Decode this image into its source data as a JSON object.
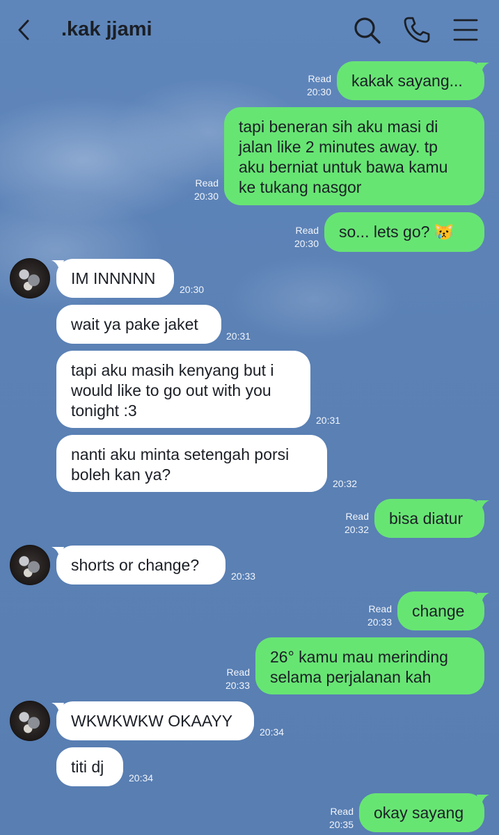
{
  "header": {
    "title": ".kak jjami",
    "back_icon": "chevron-left-icon",
    "search_icon": "search-icon",
    "call_icon": "phone-icon",
    "menu_icon": "hamburger-menu-icon"
  },
  "messages": [
    {
      "from": "me",
      "text": "kakak sayang...",
      "read": "Read",
      "time": "20:30"
    },
    {
      "from": "me",
      "text": "tapi beneran sih aku masi di\njalan like 2 minutes away. tp\naku berniat untuk bawa kamu\nke tukang nasgor",
      "read": "Read",
      "time": "20:30"
    },
    {
      "from": "me",
      "text": "so... lets go? 😿",
      "read": "Read",
      "time": "20:30"
    },
    {
      "from": "them",
      "text": "IM INNNNN",
      "time": "20:30"
    },
    {
      "from": "them",
      "text": "wait ya pake jaket",
      "time": "20:31"
    },
    {
      "from": "them",
      "text": "tapi aku masih kenyang but i\nwould like to go out with you\ntonight :3",
      "time": "20:31"
    },
    {
      "from": "them",
      "text": "nanti aku minta setengah porsi\nboleh kan ya?",
      "time": "20:32"
    },
    {
      "from": "me",
      "text": "bisa diatur",
      "read": "Read",
      "time": "20:32"
    },
    {
      "from": "them",
      "text": "shorts or change?",
      "time": "20:33"
    },
    {
      "from": "me",
      "text": "change",
      "read": "Read",
      "time": "20:33"
    },
    {
      "from": "me",
      "text": "26° kamu mau merinding\nselama perjalanan kah",
      "read": "Read",
      "time": "20:33"
    },
    {
      "from": "them",
      "text": "WKWKWKW OKAAYY",
      "time": "20:34"
    },
    {
      "from": "them",
      "text": "titi dj",
      "time": "20:34"
    },
    {
      "from": "me",
      "text": "okay sayang",
      "read": "Read",
      "time": "20:35"
    }
  ],
  "colors": {
    "outgoing_bubble": "#67e573",
    "incoming_bubble": "#ffffff",
    "background": "#5a80b4",
    "text": "#1b1f26"
  }
}
